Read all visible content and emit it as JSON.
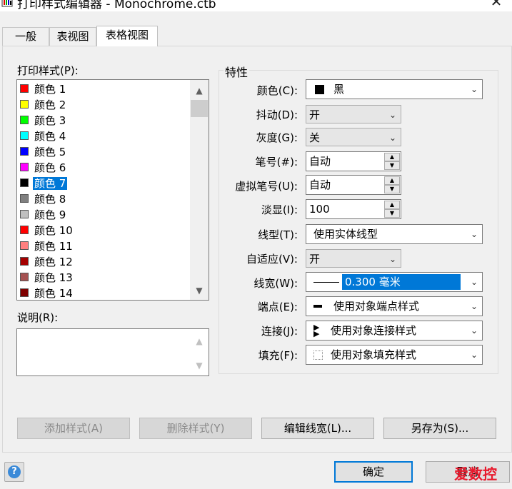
{
  "window": {
    "title": "打印样式编辑器 - Monochrome.ctb",
    "close_glyph": "✕"
  },
  "tabs": [
    {
      "label": "一般",
      "active": false
    },
    {
      "label": "表视图",
      "active": false
    },
    {
      "label": "表格视图",
      "active": true
    }
  ],
  "styles": {
    "label": "打印样式(P):",
    "items": [
      {
        "label": "颜色  1",
        "color": "#ff0000"
      },
      {
        "label": "颜色  2",
        "color": "#ffff00"
      },
      {
        "label": "颜色  3",
        "color": "#00ff00"
      },
      {
        "label": "颜色  4",
        "color": "#00ffff"
      },
      {
        "label": "颜色  5",
        "color": "#0000ff"
      },
      {
        "label": "颜色  6",
        "color": "#ff00ff"
      },
      {
        "label": "颜色  7",
        "color": "#000000",
        "selected": true
      },
      {
        "label": "颜色  8",
        "color": "#808080"
      },
      {
        "label": "颜色  9",
        "color": "#c0c0c0"
      },
      {
        "label": "颜色  10",
        "color": "#ff0000"
      },
      {
        "label": "颜色  11",
        "color": "#ff7f7f"
      },
      {
        "label": "颜色  12",
        "color": "#a50000"
      },
      {
        "label": "颜色  13",
        "color": "#a55252"
      },
      {
        "label": "颜色  14",
        "color": "#7f0000"
      }
    ]
  },
  "description": {
    "label": "说明(R):",
    "value": ""
  },
  "properties": {
    "title": "特性",
    "color": {
      "label": "颜色(C):",
      "value": "黑"
    },
    "dither": {
      "label": "抖动(D):",
      "value": "开"
    },
    "grayscale": {
      "label": "灰度(G):",
      "value": "关"
    },
    "pen": {
      "label": "笔号(#):",
      "value": "自动"
    },
    "virtual_pen": {
      "label": "虚拟笔号(U):",
      "value": "自动"
    },
    "screening": {
      "label": "淡显(I):",
      "value": "100"
    },
    "linetype": {
      "label": "线型(T):",
      "value": "使用实体线型"
    },
    "adaptive": {
      "label": "自适应(V):",
      "value": "开"
    },
    "lineweight": {
      "label": "线宽(W):",
      "value": "0.300 毫米"
    },
    "endstyle": {
      "label": "端点(E):",
      "value": "使用对象端点样式"
    },
    "joinstyle": {
      "label": "连接(J):",
      "value": "使用对象连接样式"
    },
    "fillstyle": {
      "label": "填充(F):",
      "value": "使用对象填充样式"
    }
  },
  "buttons": {
    "add": "添加样式(A)",
    "delete": "删除样式(Y)",
    "edit_lineweights": "编辑线宽(L)...",
    "save_as": "另存为(S)...",
    "ok": "确定",
    "cancel": "取消",
    "help": "?"
  },
  "watermark": "爱数控"
}
